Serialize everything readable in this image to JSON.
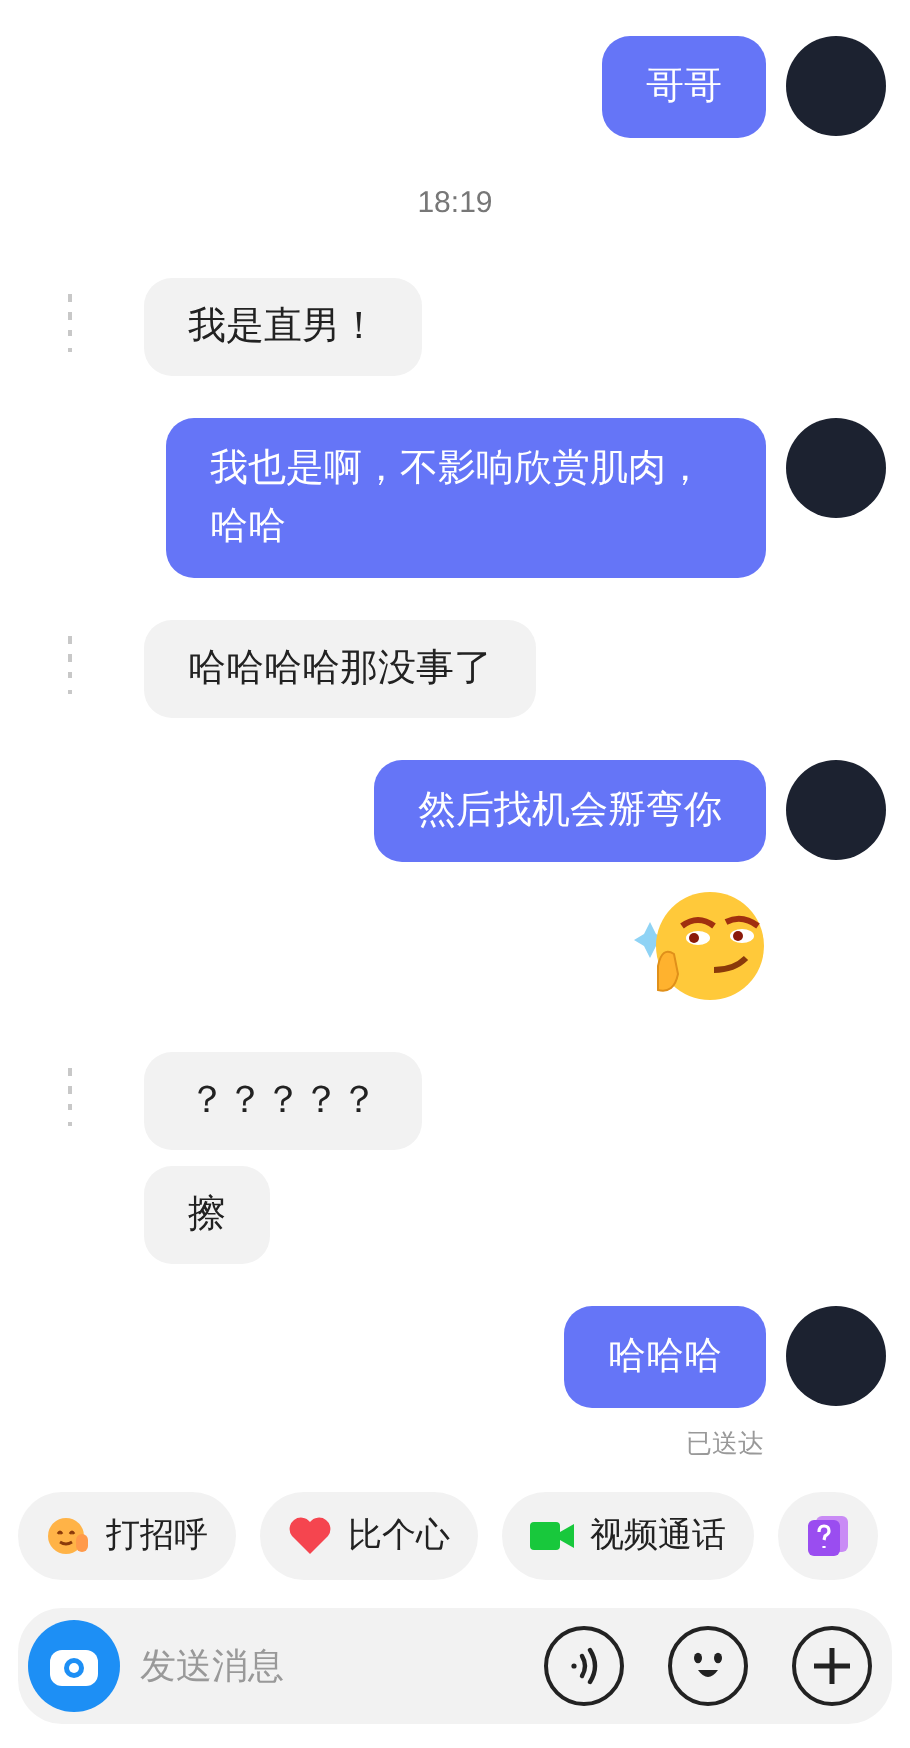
{
  "messages": [
    {
      "kind": "sent",
      "text": "哥哥"
    },
    {
      "kind": "time",
      "text": "18:19"
    },
    {
      "kind": "received",
      "text": "我是直男！"
    },
    {
      "kind": "sent",
      "text": "我也是啊，不影响欣赏肌肉，哈哈"
    },
    {
      "kind": "received",
      "text": "哈哈哈哈那没事了"
    },
    {
      "kind": "sent",
      "text": "然后找机会掰弯你"
    },
    {
      "kind": "sticker"
    },
    {
      "kind": "received",
      "text": "？？？？？"
    },
    {
      "kind": "received",
      "text": "擦"
    },
    {
      "kind": "sent",
      "text": "哈哈哈",
      "status": "已送达"
    }
  ],
  "quick_actions": [
    {
      "kind": "wave",
      "label": "打招呼"
    },
    {
      "kind": "heart",
      "label": "比个心"
    },
    {
      "kind": "video",
      "label": "视频通话"
    },
    {
      "kind": "quiz"
    }
  ],
  "composer": {
    "placeholder": "发送消息"
  }
}
